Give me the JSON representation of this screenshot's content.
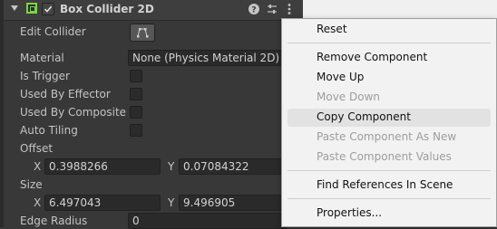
{
  "component": {
    "title": "Box Collider 2D",
    "enabled": true,
    "icon": "box-collider-icon",
    "header_icons": [
      "help-icon",
      "preset-icon",
      "kebab-menu-icon"
    ]
  },
  "properties": {
    "edit_collider_label": "Edit Collider",
    "material_label": "Material",
    "material_value": "None (Physics Material 2D)",
    "is_trigger_label": "Is Trigger",
    "used_by_effector_label": "Used By Effector",
    "used_by_composite_label": "Used By Composite",
    "auto_tiling_label": "Auto Tiling",
    "offset_label": "Offset",
    "offset": {
      "x_label": "X",
      "x": "0.3988266",
      "y_label": "Y",
      "y": "0.07084322"
    },
    "size_label": "Size",
    "size": {
      "x_label": "X",
      "x": "6.497043",
      "y_label": "Y",
      "y": "9.496905"
    },
    "edge_radius_label": "Edge Radius",
    "edge_radius": "0"
  },
  "context_menu": {
    "items": [
      {
        "label": "Reset",
        "enabled": true
      },
      {
        "label": "Remove Component",
        "enabled": true
      },
      {
        "label": "Move Up",
        "enabled": true
      },
      {
        "label": "Move Down",
        "enabled": false
      },
      {
        "label": "Copy Component",
        "enabled": true,
        "highlighted": true
      },
      {
        "label": "Paste Component As New",
        "enabled": false
      },
      {
        "label": "Paste Component Values",
        "enabled": false
      },
      {
        "label": "Find References In Scene",
        "enabled": true
      },
      {
        "label": "Properties...",
        "enabled": true
      }
    ]
  },
  "colors": {
    "accent": "#7bd34a",
    "inspector_bg": "#383838",
    "menu_bg": "#f2f2f2"
  }
}
